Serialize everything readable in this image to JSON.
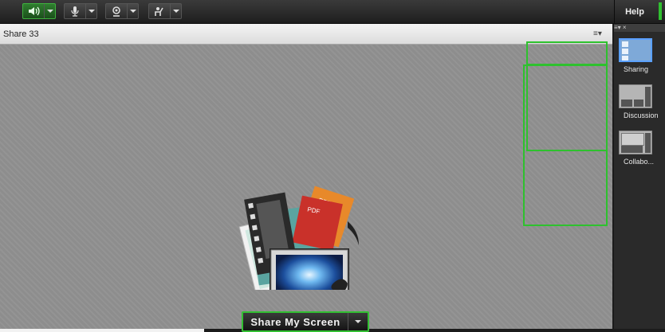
{
  "toolbar": {
    "help_label": "Help"
  },
  "pod": {
    "title": "Share 33",
    "menu_glyph": "≡▾"
  },
  "stage": {
    "share_button_label": "Share My Screen",
    "icon_labels": {
      "ppt": "PPT",
      "pdf": "PDF"
    }
  },
  "layouts_panel": {
    "header_glyph": "≡▾ ×",
    "items": [
      {
        "label": "Sharing"
      },
      {
        "label": "Discussion"
      },
      {
        "label": "Collabo..."
      }
    ]
  },
  "colors": {
    "accent_green": "#2ec12e",
    "selected_blue": "#5aa0ff"
  }
}
